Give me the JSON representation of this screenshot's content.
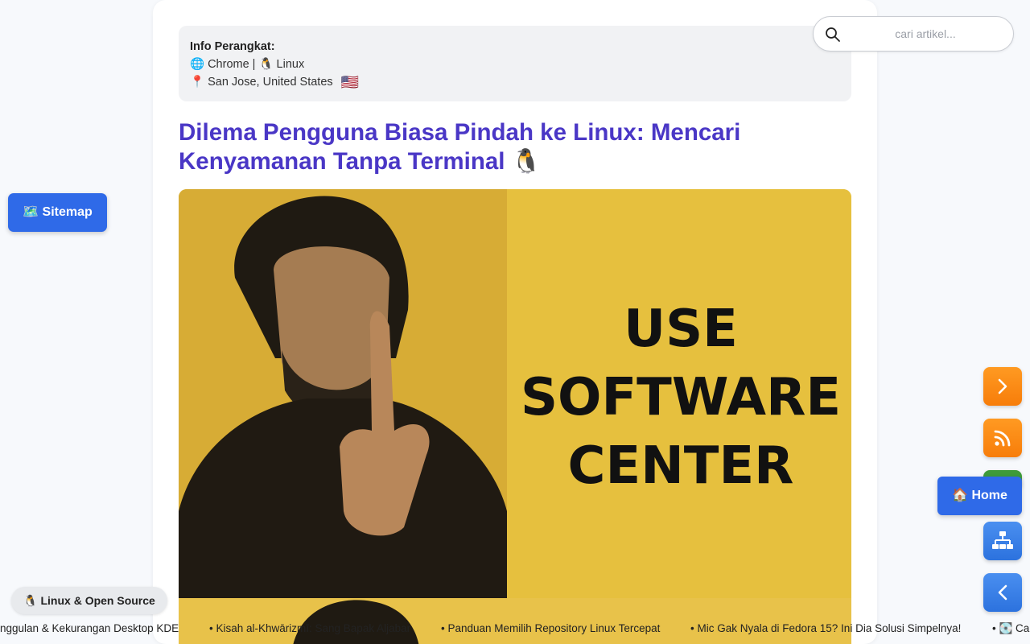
{
  "device_info": {
    "title": "Info Perangkat:",
    "browser_line": "🌐 Chrome | 🐧 Linux",
    "location_line": "📍 San Jose, United States",
    "flag": "🇺🇸"
  },
  "article": {
    "title": "Dilema Pengguna Biasa Pindah ke Linux: Mencari Kenyamanan Tanpa Terminal 🐧"
  },
  "hero_image": {
    "text_lines": [
      "USE",
      "SOFTWARE",
      "CENTER"
    ],
    "colors": {
      "background": "#e5bf3d",
      "figure": "#2a2418",
      "text": "#111111"
    }
  },
  "search": {
    "placeholder": "cari artikel...",
    "value": ""
  },
  "sitemap_button": {
    "label": "🗺️ Sitemap"
  },
  "home_button": {
    "label": "🏠 Home"
  },
  "category_pill": {
    "label": "🐧 Linux & Open Source"
  },
  "ticker": {
    "items": [
      "nggulan & Kekurangan Desktop KDE",
      "• Kisah al-Khwārizmī: Sang Bapak Aljabar",
      "• Panduan Memilih Repository Linux Tercepat",
      "• Mic Gak Nyala di Fedora 15? Ini Dia Solusi Simpelnya!",
      "• 💽 Ca"
    ]
  },
  "side_actions": {
    "next_icon": "chevron-right-icon",
    "rss_icon": "rss-icon",
    "sitemap_icon": "sitemap-tree-icon",
    "back_icon": "chevron-left-icon"
  },
  "colors": {
    "title": "#4a37c6",
    "primary_button": "#2f6ae8",
    "orange_button": "#f7850f",
    "blue_button": "#2f76e0"
  }
}
